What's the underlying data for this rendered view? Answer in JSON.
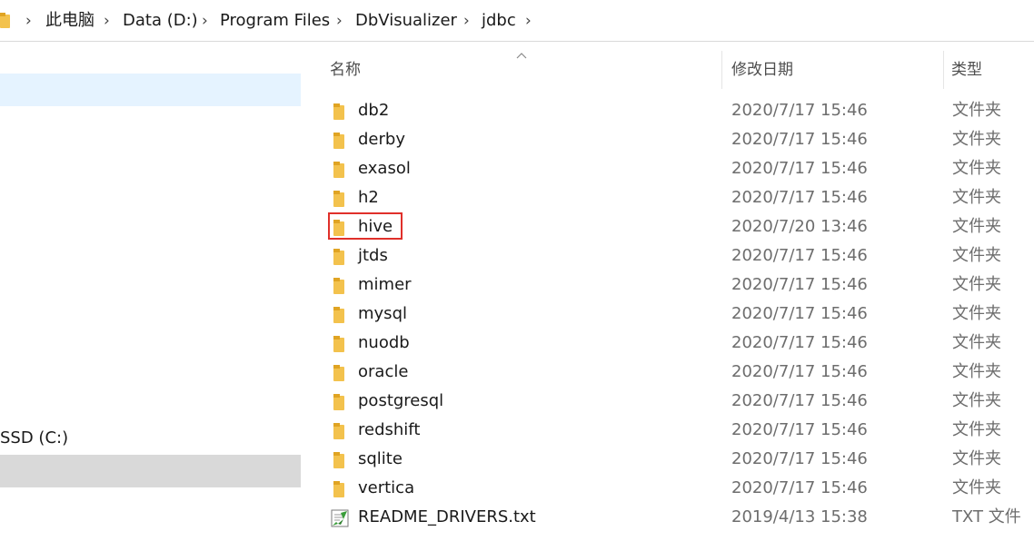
{
  "breadcrumb": {
    "items": [
      "此电脑",
      "Data (D:)",
      "Program Files",
      "DbVisualizer",
      "jdbc"
    ]
  },
  "nav": {
    "drive_label": "SSD (C:)"
  },
  "columns": {
    "name": "名称",
    "modified": "修改日期",
    "type": "类型"
  },
  "files": [
    {
      "name": "db2",
      "modified": "2020/7/17 15:46",
      "type": "文件夹",
      "icon": "folder-icon"
    },
    {
      "name": "derby",
      "modified": "2020/7/17 15:46",
      "type": "文件夹",
      "icon": "folder-icon"
    },
    {
      "name": "exasol",
      "modified": "2020/7/17 15:46",
      "type": "文件夹",
      "icon": "folder-icon"
    },
    {
      "name": "h2",
      "modified": "2020/7/17 15:46",
      "type": "文件夹",
      "icon": "folder-icon"
    },
    {
      "name": "hive",
      "modified": "2020/7/20 13:46",
      "type": "文件夹",
      "icon": "folder-icon",
      "highlighted": true
    },
    {
      "name": "jtds",
      "modified": "2020/7/17 15:46",
      "type": "文件夹",
      "icon": "folder-icon"
    },
    {
      "name": "mimer",
      "modified": "2020/7/17 15:46",
      "type": "文件夹",
      "icon": "folder-icon"
    },
    {
      "name": "mysql",
      "modified": "2020/7/17 15:46",
      "type": "文件夹",
      "icon": "folder-icon"
    },
    {
      "name": "nuodb",
      "modified": "2020/7/17 15:46",
      "type": "文件夹",
      "icon": "folder-icon"
    },
    {
      "name": "oracle",
      "modified": "2020/7/17 15:46",
      "type": "文件夹",
      "icon": "folder-icon"
    },
    {
      "name": "postgresql",
      "modified": "2020/7/17 15:46",
      "type": "文件夹",
      "icon": "folder-icon"
    },
    {
      "name": "redshift",
      "modified": "2020/7/17 15:46",
      "type": "文件夹",
      "icon": "folder-icon"
    },
    {
      "name": "sqlite",
      "modified": "2020/7/17 15:46",
      "type": "文件夹",
      "icon": "folder-icon"
    },
    {
      "name": "vertica",
      "modified": "2020/7/17 15:46",
      "type": "文件夹",
      "icon": "folder-icon"
    },
    {
      "name": "README_DRIVERS.txt",
      "modified": "2019/4/13 15:38",
      "type": "TXT 文件",
      "icon": "text-file-icon"
    }
  ],
  "colors": {
    "folder": "#f3c24d",
    "folder_tab": "#e0a423",
    "highlight": "#e0302a",
    "nav_selected": "#e5f3ff",
    "nav_hover": "#d9d9d9"
  }
}
